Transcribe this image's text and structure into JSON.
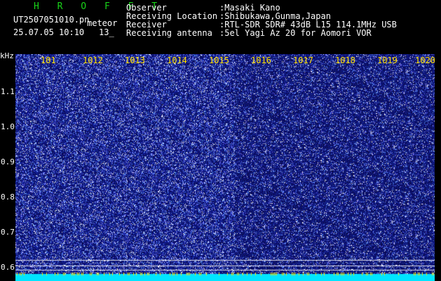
{
  "header": {
    "brand": "H R O F F T",
    "filename": "UT2507051010.pn",
    "category": "meteor",
    "datetime": "25.07.05 10:10",
    "counter": "13_",
    "fields": [
      {
        "label": "Observer",
        "value": ":Masaki Kano"
      },
      {
        "label": "Receiving Location",
        "value": ":Shibukawa,Gunma,Japan"
      },
      {
        "label": "Receiver",
        "value": ":RTL-SDR SDR# 43dB L15 114.1MHz USB"
      },
      {
        "label": "Receiving antenna",
        "value": ":5el Yagi Az 20 for Aomori VOR"
      }
    ]
  },
  "spectrogram": {
    "unit_label": "kHz",
    "y_ticks": [
      "1.1",
      "1.0",
      "0.9",
      "0.8",
      "0.7",
      "0.6"
    ],
    "time_labels": [
      "101",
      "1012",
      "1013",
      "1014",
      "1015",
      "1016",
      "1017",
      "1018",
      "1019",
      "1020"
    ],
    "colors": {
      "background": "#1d2b9e",
      "noise_light": "#6e8cff",
      "noise_white": "#ffffff",
      "bottom_band": "#00e5ff",
      "time_label": "#ffe000",
      "brand": "#19d419"
    }
  }
}
